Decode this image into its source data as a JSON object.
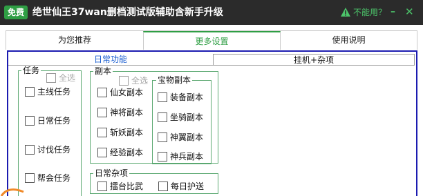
{
  "window": {
    "badge": "免费",
    "title": "绝世仙王37wan删档测试版辅助含新手升级",
    "warning_text": "不能用？",
    "minimize": "–",
    "close": "✕"
  },
  "tabs": [
    {
      "label": "为您推荐",
      "active": false
    },
    {
      "label": "更多设置",
      "active": true
    },
    {
      "label": "使用说明",
      "active": false
    }
  ],
  "subtabs": [
    {
      "label": "日常功能",
      "active": true
    },
    {
      "label": "挂机+杂项",
      "active": false
    }
  ],
  "groups": {
    "tasks": {
      "title": "任务",
      "select_all": "全选",
      "items": [
        "主线任务",
        "日常任务",
        "讨伐任务",
        "帮会任务"
      ]
    },
    "dungeons": {
      "title": "副本",
      "select_all": "全选",
      "items": [
        "仙女副本",
        "神将副本",
        "斩妖副本",
        "经验副本"
      ]
    },
    "treasure": {
      "title": "宝物副本",
      "items": [
        "装备副本",
        "坐骑副本",
        "神翼副本",
        "神兵副本"
      ]
    },
    "misc": {
      "title": "日常杂项",
      "items": [
        "擂台比武",
        "每日护送"
      ]
    }
  },
  "colors": {
    "titlebar": "#2b2b2b",
    "accent_green": "#2f9e44",
    "warn_green": "#4cc46a",
    "panel_border": "#1b1bb0",
    "subtab_active": "#1b5fd1",
    "group_border": "#5aa870"
  }
}
